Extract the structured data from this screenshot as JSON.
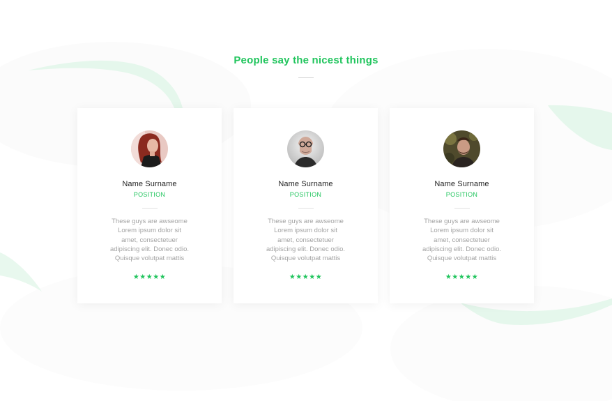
{
  "section": {
    "title": "People say the nicest things"
  },
  "colors": {
    "accent": "#22c55e",
    "name_text": "#1f1f1f",
    "body_text": "#a3a3a3",
    "wave": "#e3f6ea"
  },
  "testimonials": [
    {
      "avatar_icon": "woman-red-hair-avatar",
      "name": "Name Surname",
      "position": "POSITION",
      "quote_lines": [
        "These guys are awseome",
        "Lorem ipsum dolor sit",
        "amet, consectetuer",
        "adipiscing elit. Donec odio.",
        "Quisque volutpat mattis"
      ],
      "stars": "★★★★★",
      "rating": 5
    },
    {
      "avatar_icon": "bald-man-glasses-avatar",
      "name": "Name Surname",
      "position": "POSITION",
      "quote_lines": [
        "These guys are awseome",
        "Lorem ipsum dolor sit",
        "amet, consectetuer",
        "adipiscing elit. Donec odio.",
        "Quisque volutpat mattis"
      ],
      "stars": "★★★★★",
      "rating": 5
    },
    {
      "avatar_icon": "bearded-man-avatar",
      "name": "Name Surname",
      "position": "POSITION",
      "quote_lines": [
        "These guys are awseome",
        "Lorem ipsum dolor sit",
        "amet, consectetuer",
        "adipiscing elit. Donec odio.",
        "Quisque volutpat mattis"
      ],
      "stars": "★★★★★",
      "rating": 5
    }
  ]
}
